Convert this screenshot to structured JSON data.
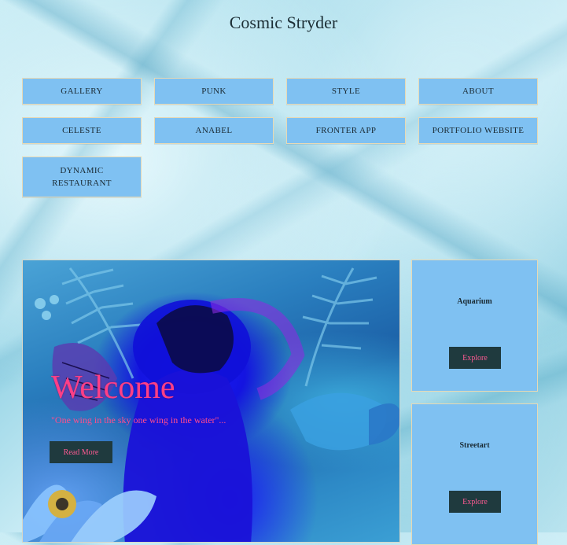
{
  "site": {
    "title": "Cosmic Stryder"
  },
  "nav": {
    "items": [
      {
        "label": "GALLERY"
      },
      {
        "label": "PUNK"
      },
      {
        "label": "STYLE"
      },
      {
        "label": "ABOUT"
      },
      {
        "label": "CELESTE"
      },
      {
        "label": "ANABEL"
      },
      {
        "label": "FRONTER APP"
      },
      {
        "label": "PORTFOLIO WEBSITE"
      },
      {
        "label": "DYNAMIC RESTAURANT"
      }
    ]
  },
  "hero": {
    "title": "Welcome",
    "subtitle": "\"One wing in the sky one wing in the water\"...",
    "button_label": "Read More"
  },
  "cards": [
    {
      "title": "Aquarium",
      "button_label": "Explore"
    },
    {
      "title": "Streetart",
      "button_label": "Explore"
    }
  ],
  "colors": {
    "nav_button_bg": "#7fc1f2",
    "dark_button_bg": "#1f3a3e",
    "accent_pink": "#ff3f86"
  }
}
